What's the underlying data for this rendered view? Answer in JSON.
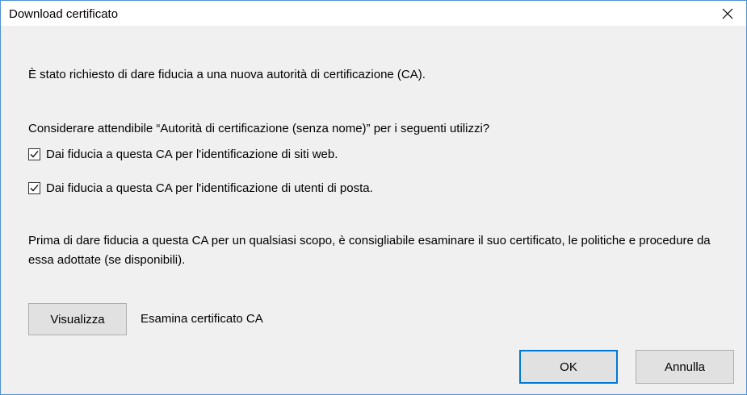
{
  "window": {
    "title": "Download certificato"
  },
  "content": {
    "intro": "È stato richiesto di dare fiducia a una nuova autorità di certificazione (CA).",
    "question": "Considerare attendibile “Autorità di certificazione (senza nome)” per i seguenti utilizzi?",
    "options": [
      {
        "label": "Dai fiducia a questa CA per l'identificazione di siti web.",
        "checked": true
      },
      {
        "label": "Dai fiducia a questa CA per l'identificazione di utenti di posta.",
        "checked": true
      }
    ],
    "warning": "Prima di dare fiducia a questa CA per un qualsiasi scopo, è consigliabile esaminare il suo certificato, le politiche e procedure da essa adottate (se disponibili)."
  },
  "view": {
    "button_label": "Visualizza",
    "description": "Esamina certificato CA"
  },
  "footer": {
    "ok_label": "OK",
    "cancel_label": "Annulla"
  },
  "colors": {
    "dialog_bg": "#f0f0f0",
    "border_accent": "#4f90d6",
    "default_button_border": "#0078d7"
  }
}
